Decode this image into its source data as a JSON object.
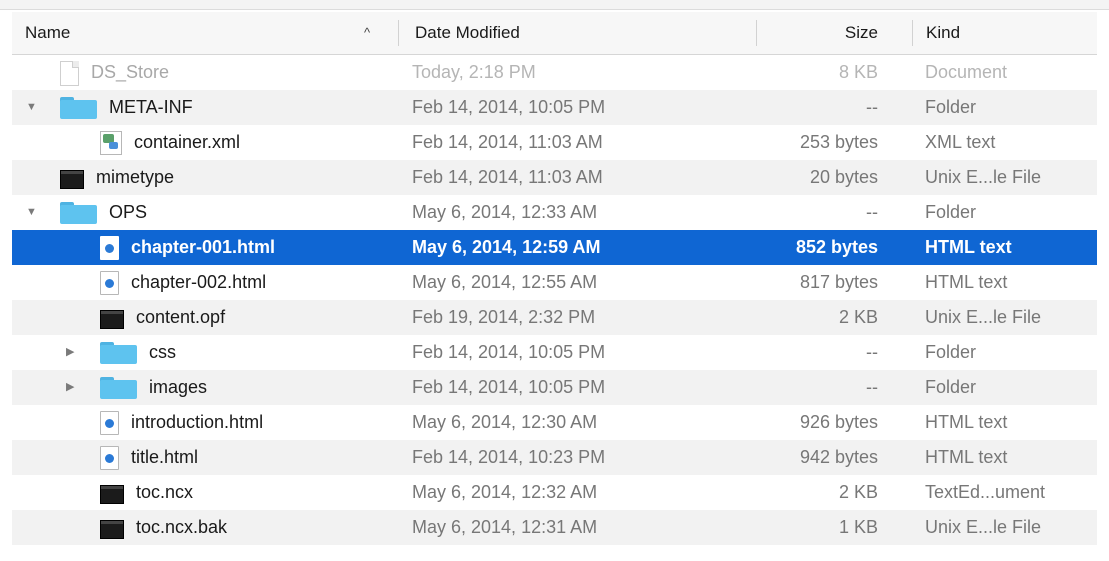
{
  "columns": {
    "name": "Name",
    "sort_indicator": "^",
    "date_modified": "Date Modified",
    "size": "Size",
    "kind": "Kind"
  },
  "rows": [
    {
      "name": "DS_Store",
      "date": "Today, 2:18 PM",
      "size": "8 KB",
      "kind": "Document",
      "icon": "document-icon",
      "depth": 0,
      "disclosure": "none",
      "state": "dimmed"
    },
    {
      "name": "META-INF",
      "date": "Feb 14, 2014, 10:05 PM",
      "size": "--",
      "kind": "Folder",
      "icon": "folder-icon",
      "depth": 0,
      "disclosure": "expanded",
      "state": "normal"
    },
    {
      "name": "container.xml",
      "date": "Feb 14, 2014, 11:03 AM",
      "size": "253 bytes",
      "kind": "XML text",
      "icon": "xml-file-icon",
      "depth": 1,
      "disclosure": "none",
      "state": "normal"
    },
    {
      "name": "mimetype",
      "date": "Feb 14, 2014, 11:03 AM",
      "size": "20 bytes",
      "kind": "Unix E...le File",
      "icon": "unix-executable-icon",
      "depth": 0,
      "disclosure": "none",
      "state": "normal"
    },
    {
      "name": "OPS",
      "date": "May 6, 2014, 12:33 AM",
      "size": "--",
      "kind": "Folder",
      "icon": "folder-icon",
      "depth": 0,
      "disclosure": "expanded",
      "state": "normal"
    },
    {
      "name": "chapter-001.html",
      "date": "May 6, 2014, 12:59 AM",
      "size": "852 bytes",
      "kind": "HTML text",
      "icon": "html-file-icon",
      "depth": 1,
      "disclosure": "none",
      "state": "selected"
    },
    {
      "name": "chapter-002.html",
      "date": "May 6, 2014, 12:55 AM",
      "size": "817 bytes",
      "kind": "HTML text",
      "icon": "html-file-icon",
      "depth": 1,
      "disclosure": "none",
      "state": "normal"
    },
    {
      "name": "content.opf",
      "date": "Feb 19, 2014, 2:32 PM",
      "size": "2 KB",
      "kind": "Unix E...le File",
      "icon": "unix-executable-icon",
      "depth": 1,
      "disclosure": "none",
      "state": "normal"
    },
    {
      "name": "css",
      "date": "Feb 14, 2014, 10:05 PM",
      "size": "--",
      "kind": "Folder",
      "icon": "folder-icon",
      "depth": 1,
      "disclosure": "collapsed",
      "state": "normal"
    },
    {
      "name": "images",
      "date": "Feb 14, 2014, 10:05 PM",
      "size": "--",
      "kind": "Folder",
      "icon": "folder-icon",
      "depth": 1,
      "disclosure": "collapsed",
      "state": "normal"
    },
    {
      "name": "introduction.html",
      "date": "May 6, 2014, 12:30 AM",
      "size": "926 bytes",
      "kind": "HTML text",
      "icon": "html-file-icon",
      "depth": 1,
      "disclosure": "none",
      "state": "normal"
    },
    {
      "name": "title.html",
      "date": "Feb 14, 2014, 10:23 PM",
      "size": "942 bytes",
      "kind": "HTML text",
      "icon": "html-file-icon",
      "depth": 1,
      "disclosure": "none",
      "state": "normal"
    },
    {
      "name": "toc.ncx",
      "date": "May 6, 2014, 12:32 AM",
      "size": "2 KB",
      "kind": "TextEd...ument",
      "icon": "unix-executable-icon",
      "depth": 1,
      "disclosure": "none",
      "state": "normal"
    },
    {
      "name": "toc.ncx.bak",
      "date": "May 6, 2014, 12:31 AM",
      "size": "1 KB",
      "kind": "Unix E...le File",
      "icon": "unix-executable-icon",
      "depth": 1,
      "disclosure": "none",
      "state": "normal"
    }
  ],
  "colors": {
    "selection": "#0f66d3",
    "folder": "#5ec3ef",
    "alt_row": "#f2f2f2"
  }
}
